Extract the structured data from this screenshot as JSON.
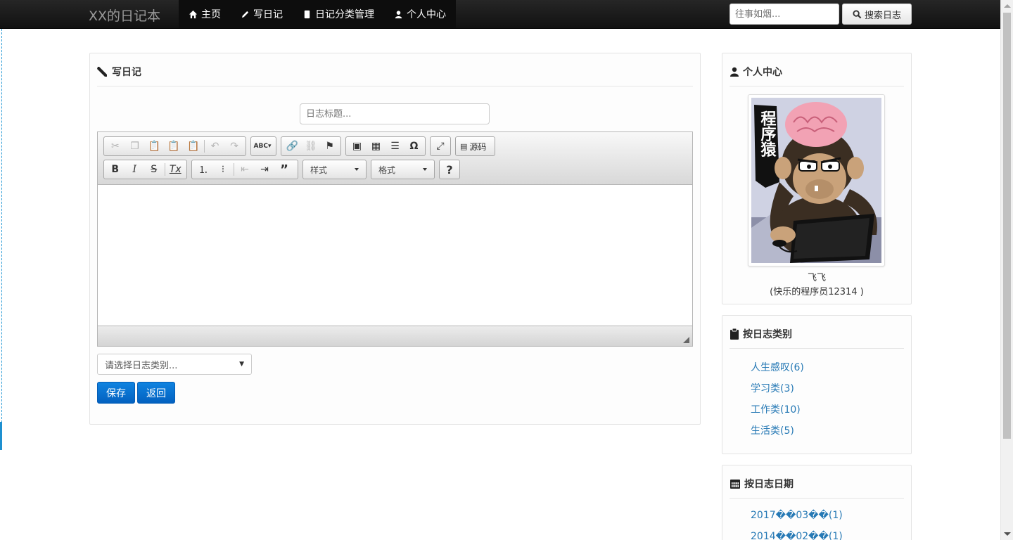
{
  "navbar": {
    "brand": "XX的日记本",
    "items": [
      {
        "label": "主页"
      },
      {
        "label": "写日记"
      },
      {
        "label": "日记分类管理"
      },
      {
        "label": "个人中心"
      }
    ],
    "search_placeholder": "往事如烟...",
    "search_button": "搜索日志"
  },
  "write": {
    "title": "写日记",
    "title_placeholder": "日志标题...",
    "source_label": "源码",
    "style_label": "样式",
    "format_label": "格式",
    "help_label": "?",
    "category_placeholder": "请选择日志类别...",
    "save_label": "保存",
    "back_label": "返回"
  },
  "profile": {
    "title": "个人中心",
    "avatar_caption": "程序猿",
    "name": "飞飞",
    "signature": "(快乐的程序员12314 )"
  },
  "categories": {
    "title": "按日志类别",
    "items": [
      {
        "label": "人生感叹(6)"
      },
      {
        "label": "学习类(3)"
      },
      {
        "label": "工作类(10)"
      },
      {
        "label": "生活类(5)"
      }
    ]
  },
  "dates": {
    "title": "按日志日期",
    "items": [
      {
        "label": "2017��03��(1)"
      },
      {
        "label": "2014��02��(1)"
      }
    ]
  }
}
